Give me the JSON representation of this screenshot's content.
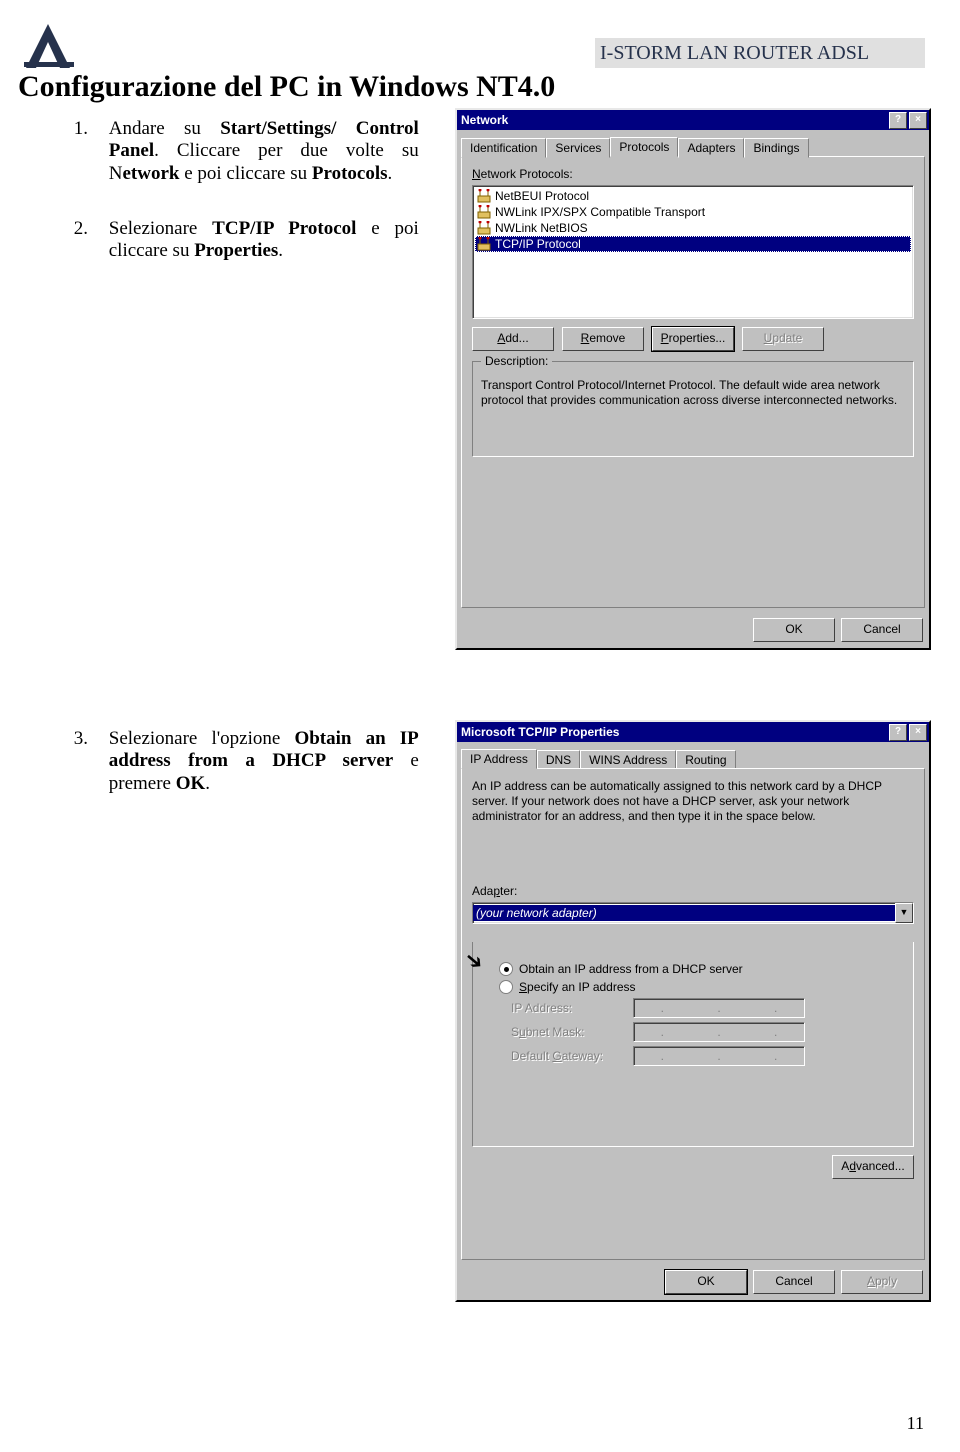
{
  "page": {
    "header_label": "I-STORM LAN ROUTER ADSL",
    "section_title": "Configurazione del  PC in Windows NT4.0",
    "page_number": "11"
  },
  "steps": {
    "s1_num": "1.",
    "s1_a": "Andare  su  ",
    "s1_b": "Start/Settings/ Control Panel",
    "s1_c": ". Cliccare per  due volte su N",
    "s1_d": "etwork",
    "s1_e": " e poi cliccare su ",
    "s1_f": "Protocols",
    "s1_g": ". ",
    "s2_num": "2.",
    "s2_a": "Selezionare ",
    "s2_b": "TCP/IP Protocol",
    "s2_c": " e poi cliccare su  ",
    "s2_d": "Properties",
    "s2_e": ".",
    "s3_num": "3.",
    "s3_a": "Selezionare l'opzione ",
    "s3_b": "Obtain an IP address from a DHCP server ",
    "s3_c": "e premere ",
    "s3_d": "OK",
    "s3_e": "."
  },
  "win1": {
    "title": "Network",
    "help": "?",
    "close": "×",
    "tabs": [
      "Identification",
      "Services",
      "Protocols",
      "Adapters",
      "Bindings"
    ],
    "list_label": "Network Protocols:",
    "items": [
      "NetBEUI Protocol",
      "NWLink IPX/SPX Compatible Transport",
      "NWLink NetBIOS",
      "TCP/IP Protocol"
    ],
    "btn_add": "Add...",
    "btn_remove": "Remove",
    "btn_props": "Properties...",
    "btn_update": "Update",
    "group_desc": "Description:",
    "desc_text": "Transport Control Protocol/Internet Protocol. The default wide area network protocol that provides communication across diverse interconnected networks.",
    "ok": "OK",
    "cancel": "Cancel"
  },
  "win2": {
    "title": "Microsoft TCP/IP Properties",
    "help": "?",
    "close": "×",
    "tabs": [
      "IP Address",
      "DNS",
      "WINS Address",
      "Routing"
    ],
    "info": "An IP address can be automatically assigned to this network card by a DHCP server. If your network does not have a DHCP server, ask your network administrator for an address, and then type it in the space below.",
    "adapter_label": "Adapter:",
    "adapter_value": "(your network adapter)",
    "radio1": "Obtain an IP address from a DHCP server",
    "radio2": "Specify an IP address",
    "ip_label": "IP Address:",
    "mask_label": "Subnet Mask:",
    "gw_label": "Default Gateway:",
    "advanced": "Advanced...",
    "ok": "OK",
    "cancel": "Cancel",
    "apply": "Apply"
  }
}
